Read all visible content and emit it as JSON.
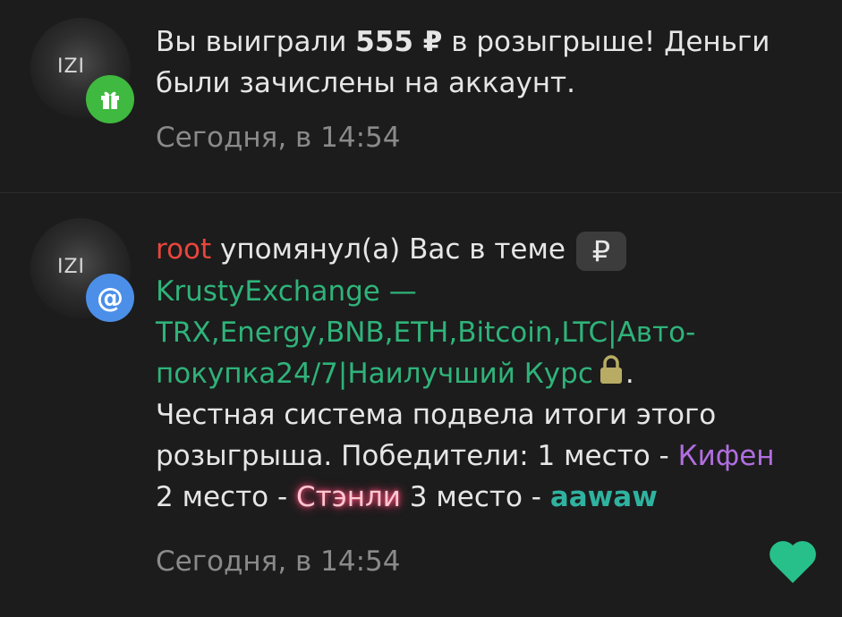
{
  "notifications": [
    {
      "avatar_text": "IZI",
      "badge_icon": "gift-icon",
      "text_before": "Вы выиграли ",
      "amount": "555 ₽",
      "text_after": " в розыгрыше! Деньги",
      "line2": "были зачислены на аккаунт.",
      "time": "Сегодня, в 14:54"
    },
    {
      "avatar_text": "IZI",
      "badge_icon": "at-icon",
      "badge_text": "@",
      "username": "root",
      "mention_text": " упомянул(а) Вас в теме",
      "prefix_badge": "₽",
      "thread_line1": "KrustyExchange —",
      "thread_line2": "TRX,Energy,BNB,ETH,Bitcoin,LTC|Авто-",
      "thread_line3": "покупка24/7|Наилучший Курс",
      "period": ".",
      "body_line1": "Честная система подвела итоги этого",
      "body_line2_prefix": "розыгрыша. Победители: 1 место - ",
      "winner1": "Кифен",
      "body_line3_prefix": "2 место - ",
      "winner2": "Стэнли",
      "body_line3_mid": " 3 место - ",
      "winner3": "aawaw",
      "time": "Сегодня, в 14:54",
      "like_icon": "heart-icon"
    }
  ],
  "colors": {
    "background": "#1c1c1c",
    "username": "#e8453c",
    "link": "#2fb37a",
    "winner1": "#b16ee0",
    "winner2": "#ffc7cf",
    "winner3": "#2fb3a0",
    "gift_badge": "#3fb93f",
    "mention_badge": "#4c8fe8",
    "heart": "#27c08a"
  }
}
